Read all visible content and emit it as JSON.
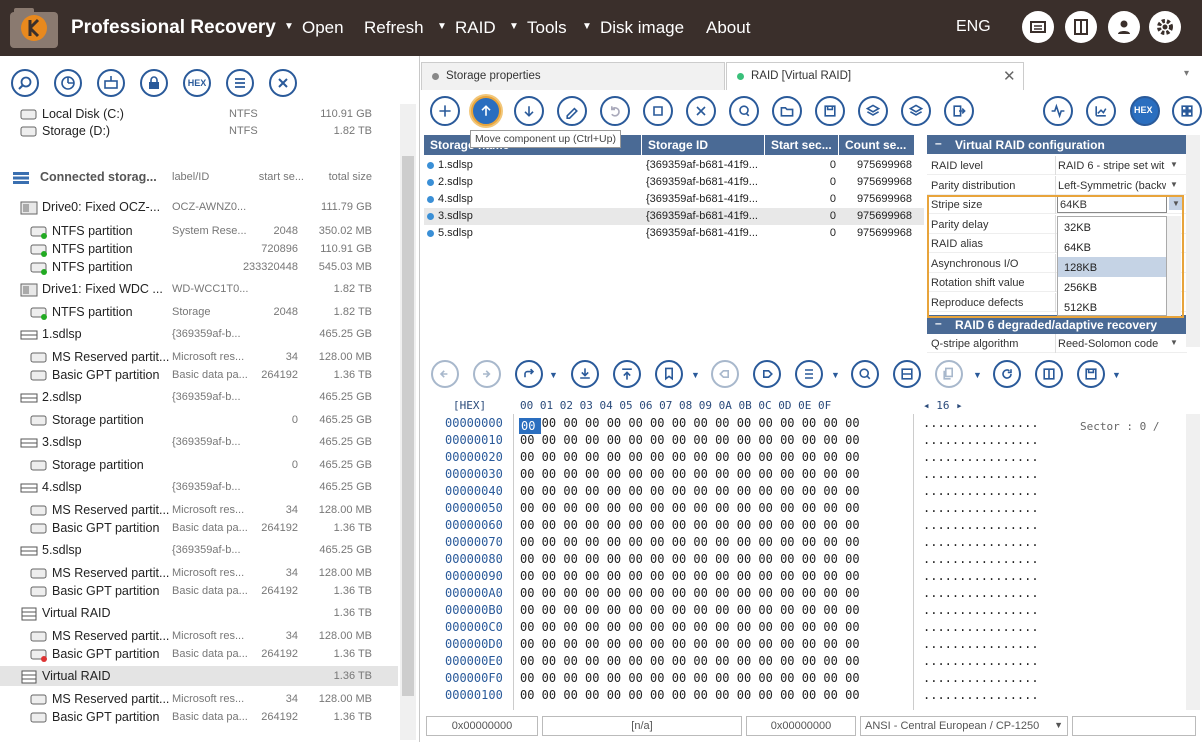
{
  "app": {
    "title": "Professional Recovery",
    "menu": [
      "Open",
      "Refresh",
      "RAID",
      "Tools",
      "Disk image",
      "About"
    ],
    "lang": "ENG"
  },
  "left": {
    "rows": [
      {
        "name": "Local Disk (C:)",
        "label": "NTFS",
        "start": "",
        "size": "110.91 GB"
      },
      {
        "name": "Storage (D:)",
        "label": "NTFS",
        "start": "",
        "size": "1.82 TB"
      },
      {
        "name": "Connected storag...",
        "label": "label/ID",
        "start": "start se...",
        "size": "total size"
      },
      {
        "name": "Drive0: Fixed OCZ-...",
        "label": "OCZ-AWNZ0...",
        "start": "",
        "size": "111.79 GB"
      },
      {
        "name": "NTFS partition",
        "label": "System Rese...",
        "start": "2048",
        "size": "350.02 MB"
      },
      {
        "name": "NTFS partition",
        "label": "",
        "start": "720896",
        "size": "110.91 GB"
      },
      {
        "name": "NTFS partition",
        "label": "",
        "start": "233320448",
        "size": "545.03 MB"
      },
      {
        "name": "Drive1: Fixed WDC ...",
        "label": "WD-WCC1T0...",
        "start": "",
        "size": "1.82 TB"
      },
      {
        "name": "NTFS partition",
        "label": "Storage",
        "start": "2048",
        "size": "1.82 TB"
      },
      {
        "name": "1.sdlsp",
        "label": "{369359af-b...",
        "start": "",
        "size": "465.25 GB"
      },
      {
        "name": "MS Reserved partit...",
        "label": "Microsoft res...",
        "start": "34",
        "size": "128.00 MB"
      },
      {
        "name": "Basic GPT partition",
        "label": "Basic data pa...",
        "start": "264192",
        "size": "1.36 TB"
      },
      {
        "name": "2.sdlsp",
        "label": "{369359af-b...",
        "start": "",
        "size": "465.25 GB"
      },
      {
        "name": "Storage partition",
        "label": "",
        "start": "0",
        "size": "465.25 GB"
      },
      {
        "name": "3.sdlsp",
        "label": "{369359af-b...",
        "start": "",
        "size": "465.25 GB"
      },
      {
        "name": "Storage partition",
        "label": "",
        "start": "0",
        "size": "465.25 GB"
      },
      {
        "name": "4.sdlsp",
        "label": "{369359af-b...",
        "start": "",
        "size": "465.25 GB"
      },
      {
        "name": "MS Reserved partit...",
        "label": "Microsoft res...",
        "start": "34",
        "size": "128.00 MB"
      },
      {
        "name": "Basic GPT partition",
        "label": "Basic data pa...",
        "start": "264192",
        "size": "1.36 TB"
      },
      {
        "name": "5.sdlsp",
        "label": "{369359af-b...",
        "start": "",
        "size": "465.25 GB"
      },
      {
        "name": "MS Reserved partit...",
        "label": "Microsoft res...",
        "start": "34",
        "size": "128.00 MB"
      },
      {
        "name": "Basic GPT partition",
        "label": "Basic data pa...",
        "start": "264192",
        "size": "1.36 TB"
      },
      {
        "name": "Virtual RAID",
        "label": "",
        "start": "",
        "size": "1.36 TB"
      },
      {
        "name": "MS Reserved partit...",
        "label": "Microsoft res...",
        "start": "34",
        "size": "128.00 MB"
      },
      {
        "name": "Basic GPT partition",
        "label": "Basic data pa...",
        "start": "264192",
        "size": "1.36 TB"
      },
      {
        "name": "Virtual RAID",
        "label": "",
        "start": "",
        "size": "1.36 TB"
      },
      {
        "name": "MS Reserved partit...",
        "label": "Microsoft res...",
        "start": "34",
        "size": "128.00 MB"
      },
      {
        "name": "Basic GPT partition",
        "label": "Basic data pa...",
        "start": "264192",
        "size": "1.36 TB"
      }
    ]
  },
  "tabs": [
    "Storage properties",
    "RAID [Virtual RAID]"
  ],
  "tooltip": "Move component up (Ctrl+Up)",
  "grid": {
    "headers": [
      "Storage name",
      "Storage ID",
      "Start sec...",
      "Count se..."
    ],
    "rows": [
      {
        "name": "1.sdlsp",
        "id": "{369359af-b681-41f9...",
        "start": "0",
        "count": "975699968"
      },
      {
        "name": "2.sdlsp",
        "id": "{369359af-b681-41f9...",
        "start": "0",
        "count": "975699968"
      },
      {
        "name": "4.sdlsp",
        "id": "{369359af-b681-41f9...",
        "start": "0",
        "count": "975699968"
      },
      {
        "name": "3.sdlsp",
        "id": "{369359af-b681-41f9...",
        "start": "0",
        "count": "975699968"
      },
      {
        "name": "5.sdlsp",
        "id": "{369359af-b681-41f9...",
        "start": "0",
        "count": "975699968"
      }
    ]
  },
  "props": {
    "section1": "Virtual RAID configuration",
    "rows": [
      {
        "k": "RAID level",
        "v": "RAID 6 - stripe set wit"
      },
      {
        "k": "Parity distribution",
        "v": "Left-Symmetric (backw"
      },
      {
        "k": "Stripe size",
        "v": "64KB"
      },
      {
        "k": "Parity delay",
        "v": ""
      },
      {
        "k": "RAID alias",
        "v": ""
      },
      {
        "k": "Asynchronous I/O",
        "v": ""
      },
      {
        "k": "Rotation shift value",
        "v": ""
      },
      {
        "k": "Reproduce defects",
        "v": ""
      }
    ],
    "section2": "RAID 6 degraded/adaptive recovery",
    "row_last": {
      "k": "Q-stripe algorithm",
      "v": "Reed-Solomon code"
    },
    "options": [
      "32KB",
      "64KB",
      "128KB",
      "256KB",
      "512KB"
    ]
  },
  "hex": {
    "label": "[HEX]",
    "cols": "00 01 02 03 04 05 06 07 08 09 0A 0B 0C 0D 0E 0F",
    "width": "◂ 16 ▸",
    "sector": "Sector : 0 /",
    "cursor": "00",
    "addrs": [
      "00000000",
      "00000010",
      "00000020",
      "00000030",
      "00000040",
      "00000050",
      "00000060",
      "00000070",
      "00000080",
      "00000090",
      "000000A0",
      "000000B0",
      "000000C0",
      "000000D0",
      "000000E0",
      "000000F0",
      "00000100"
    ],
    "bytes": "00 00 00 00 00 00 00 00 00 00 00 00 00 00 00 00",
    "ascii": "................"
  },
  "status": [
    "0x00000000",
    "[n/a]",
    "0x00000000",
    "ANSI - Central European / CP-1250"
  ]
}
